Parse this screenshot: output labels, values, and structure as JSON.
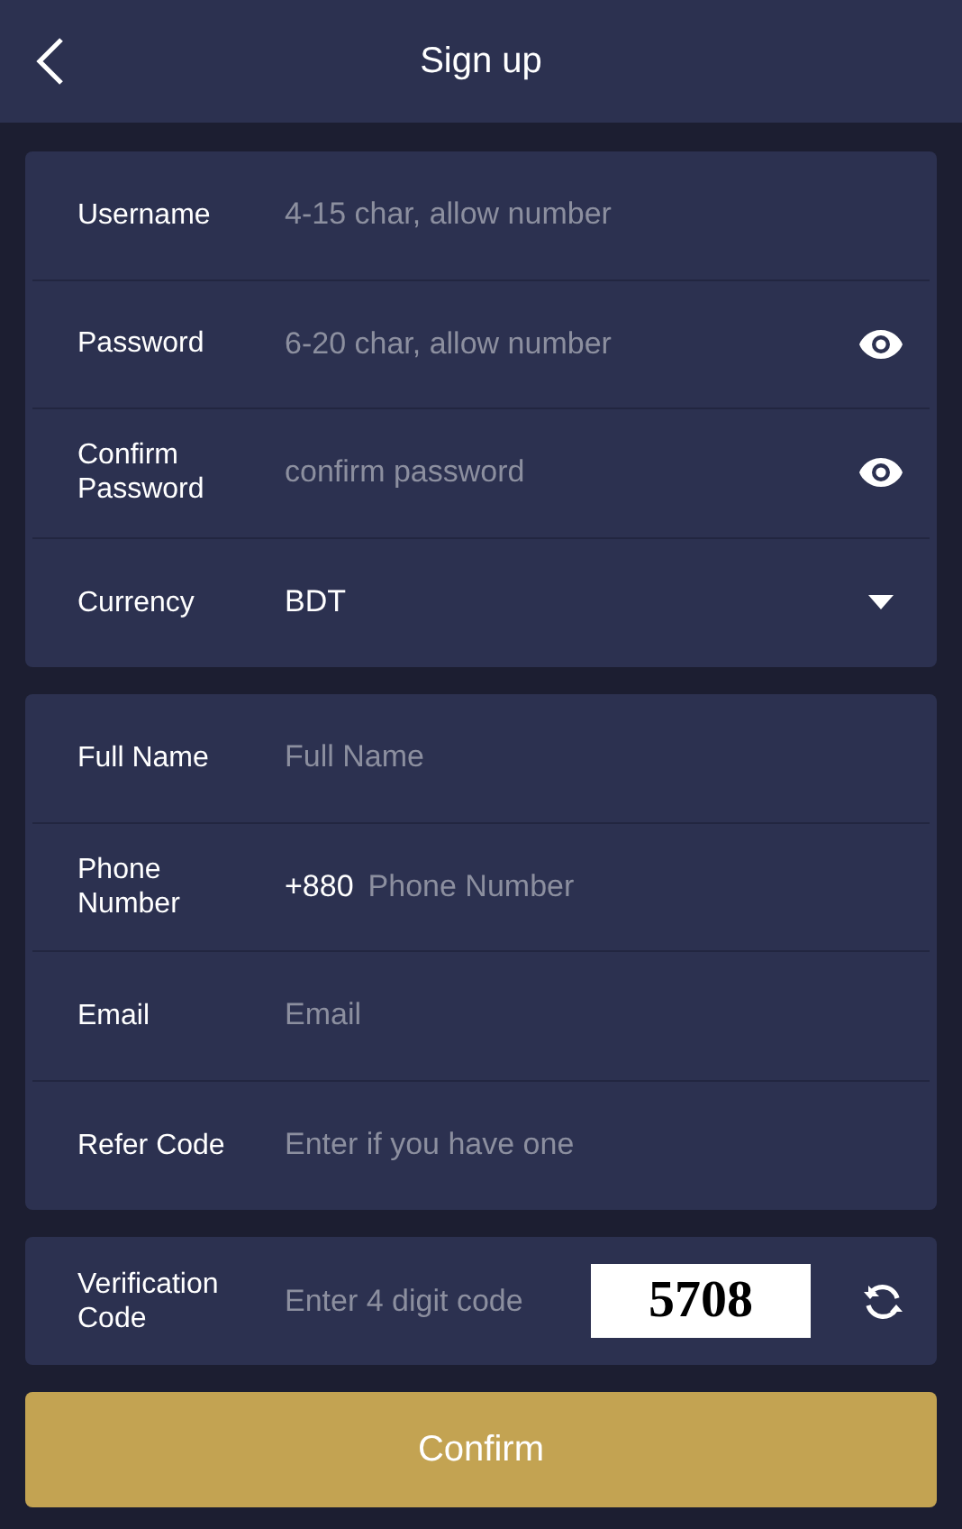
{
  "header": {
    "title": "Sign up"
  },
  "sections": [
    {
      "fields": [
        {
          "kind": "text",
          "label": "Username",
          "placeholder": "4-15 char, allow number"
        },
        {
          "kind": "password",
          "label": "Password",
          "placeholder": "6-20 char, allow number"
        },
        {
          "kind": "password",
          "label": "Confirm Password",
          "placeholder": "confirm password"
        },
        {
          "kind": "select",
          "label": "Currency",
          "value": "BDT"
        }
      ]
    },
    {
      "fields": [
        {
          "kind": "text",
          "label": "Full Name",
          "placeholder": "Full Name"
        },
        {
          "kind": "phone",
          "label": "Phone Number",
          "prefix": "+880",
          "placeholder": "Phone Number"
        },
        {
          "kind": "text",
          "label": "Email",
          "placeholder": "Email"
        },
        {
          "kind": "text",
          "label": "Refer Code",
          "placeholder": "Enter if you have one"
        }
      ]
    },
    {
      "fields": [
        {
          "kind": "captcha",
          "label": "Verification Code",
          "placeholder": "Enter 4 digit code",
          "code": "5708"
        }
      ]
    }
  ],
  "confirm_button": "Confirm"
}
